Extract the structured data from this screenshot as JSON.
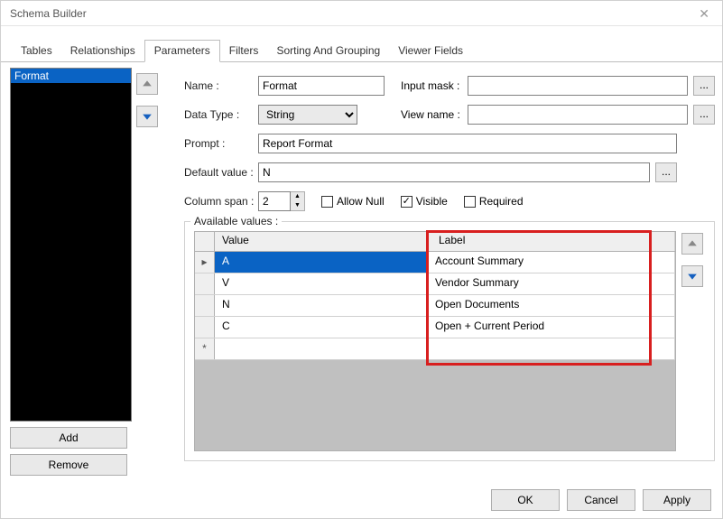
{
  "window": {
    "title": "Schema Builder"
  },
  "tabs": [
    "Tables",
    "Relationships",
    "Parameters",
    "Filters",
    "Sorting And Grouping",
    "Viewer Fields"
  ],
  "activeTab": 2,
  "paramList": {
    "items": [
      "Format"
    ],
    "selectedIndex": 0
  },
  "sideButtons": {
    "add": "Add",
    "remove": "Remove"
  },
  "fields": {
    "name_lbl": "Name :",
    "name_val": "Format",
    "inputmask_lbl": "Input mask :",
    "inputmask_val": "",
    "datatype_lbl": "Data Type :",
    "datatype_val": "String",
    "viewname_lbl": "View name :",
    "viewname_val": "",
    "prompt_lbl": "Prompt :",
    "prompt_val": "Report Format",
    "default_lbl": "Default value :",
    "default_val": "N",
    "colspan_lbl": "Column span :",
    "colspan_val": "2",
    "allownull_lbl": "Allow Null",
    "allownull_chk": false,
    "visible_lbl": "Visible",
    "visible_chk": true,
    "required_lbl": "Required",
    "required_chk": false,
    "dots": "..."
  },
  "grid": {
    "title": "Available values :",
    "col_value": "Value",
    "col_label": "Label",
    "rows": [
      {
        "value": "A",
        "label": "Account Summary",
        "selected": true,
        "marker": "▸"
      },
      {
        "value": "V",
        "label": "Vendor Summary",
        "selected": false,
        "marker": ""
      },
      {
        "value": "N",
        "label": "Open Documents",
        "selected": false,
        "marker": ""
      },
      {
        "value": "C",
        "label": "Open + Current Period",
        "selected": false,
        "marker": ""
      },
      {
        "value": "",
        "label": "",
        "selected": false,
        "marker": "*"
      }
    ]
  },
  "footer": {
    "ok": "OK",
    "cancel": "Cancel",
    "apply": "Apply"
  }
}
